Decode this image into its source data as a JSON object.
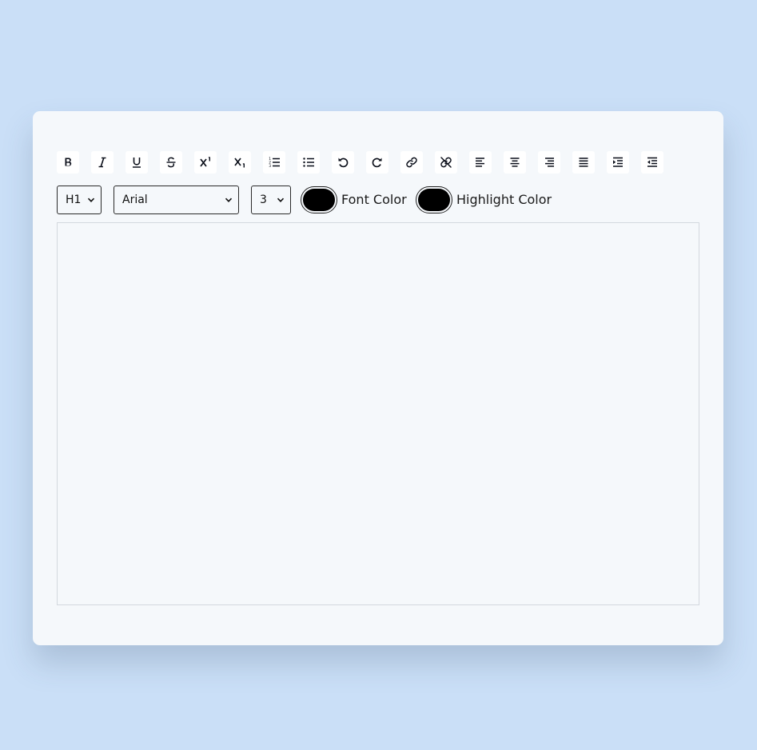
{
  "toolbar": {
    "buttons": [
      {
        "name": "bold-button",
        "icon": "bold-icon",
        "glyph": "B"
      },
      {
        "name": "italic-button",
        "icon": "italic-icon",
        "glyph": "I"
      },
      {
        "name": "underline-button",
        "icon": "underline-icon",
        "glyph": "U"
      },
      {
        "name": "strikethrough-button",
        "icon": "strikethrough-icon",
        "glyph": "S"
      },
      {
        "name": "superscript-button",
        "icon": "superscript-icon",
        "glyph": "X"
      },
      {
        "name": "subscript-button",
        "icon": "subscript-icon",
        "glyph": "X"
      },
      {
        "name": "ordered-list-button",
        "icon": "ordered-list-icon"
      },
      {
        "name": "unordered-list-button",
        "icon": "unordered-list-icon"
      },
      {
        "name": "undo-button",
        "icon": "undo-icon"
      },
      {
        "name": "redo-button",
        "icon": "redo-icon"
      },
      {
        "name": "link-button",
        "icon": "link-icon"
      },
      {
        "name": "unlink-button",
        "icon": "unlink-icon"
      },
      {
        "name": "align-left-button",
        "icon": "align-left-icon"
      },
      {
        "name": "align-center-button",
        "icon": "align-center-icon"
      },
      {
        "name": "align-right-button",
        "icon": "align-right-icon"
      },
      {
        "name": "align-justify-button",
        "icon": "align-justify-icon"
      },
      {
        "name": "indent-button",
        "icon": "indent-icon"
      },
      {
        "name": "outdent-button",
        "icon": "outdent-icon"
      }
    ]
  },
  "options": {
    "heading_select": {
      "value": "H1"
    },
    "font_select": {
      "value": "Arial"
    },
    "size_select": {
      "value": "3"
    },
    "font_color": {
      "label": "Font Color",
      "value": "#000000"
    },
    "highlight_color": {
      "label": "Highlight Color",
      "value": "#000000"
    }
  },
  "editor": {
    "content": ""
  },
  "colors": {
    "background": "#cadff7",
    "card": "#f5f8fb",
    "button": "#ffffff",
    "icon": "#0b0f1a",
    "editor_border": "#d3d8de"
  }
}
